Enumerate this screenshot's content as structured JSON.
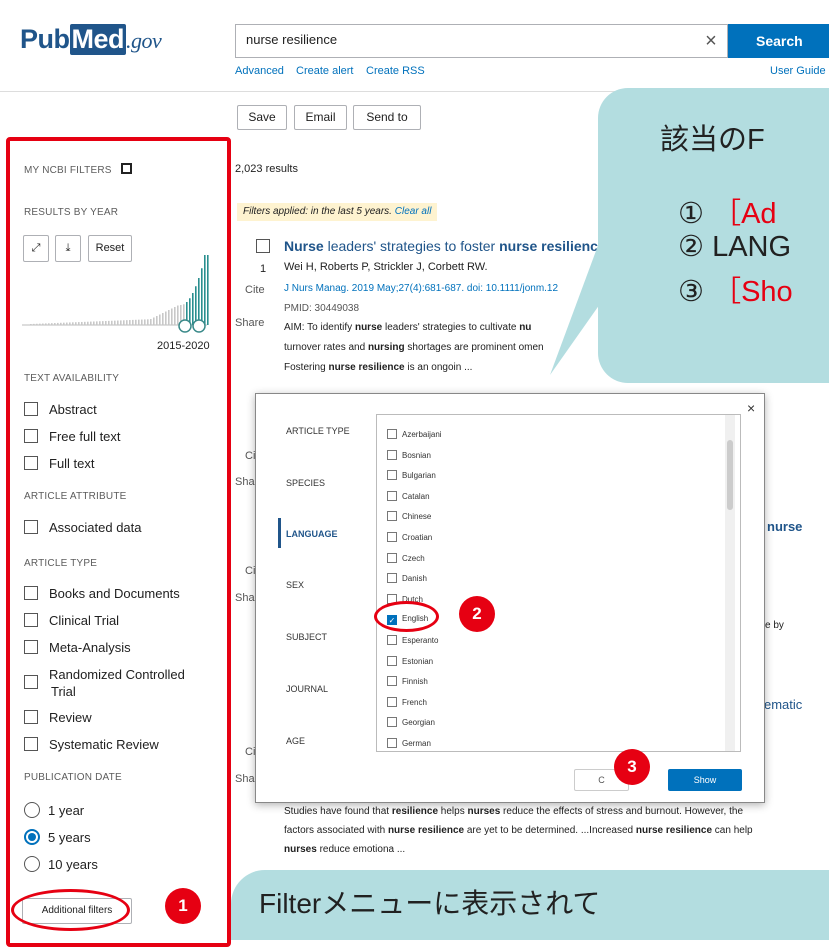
{
  "header": {
    "logo_pub": "Pub",
    "logo_med": "Med",
    "logo_gov": ".gov",
    "search_value": "nurse resilience",
    "clear_icon": "×",
    "search_label": "Search",
    "links": [
      "Advanced",
      "Create alert",
      "Create RSS"
    ],
    "user_guide": "User Guide"
  },
  "toolbar": {
    "save": "Save",
    "email": "Email",
    "send_to": "Send to",
    "s": "S"
  },
  "sidebar": {
    "my_ncbi": "MY NCBI FILTERS",
    "results_by_year": "RESULTS BY YEAR",
    "reset": "Reset",
    "year_range": "2015-2020",
    "text_availability": "TEXT AVAILABILITY",
    "text_items": [
      "Abstract",
      "Free full text",
      "Full text"
    ],
    "article_attribute": "ARTICLE ATTRIBUTE",
    "attribute_items": [
      "Associated data"
    ],
    "article_type": "ARTICLE TYPE",
    "type_items": [
      "Books and Documents",
      "Clinical Trial",
      "Meta-Analysis",
      "Randomized Controlled",
      "Trial",
      "Review",
      "Systematic Review"
    ],
    "publication_date": "PUBLICATION DATE",
    "date_items": [
      "1 year",
      "5 years",
      "10 years"
    ],
    "date_selected": 1,
    "additional_filters": "Additional filters"
  },
  "results": {
    "count": "2,023 results",
    "filters_applied": "Filters applied: in the last 5 years.",
    "clear_all": "Clear all",
    "item1": {
      "number": "1",
      "title_a": "Nurse",
      "title_b": " leaders' strategies to foster ",
      "title_c": "nurse resilienc",
      "authors": "Wei H, Roberts P, Strickler J, Corbett RW.",
      "cite": "Cite",
      "share": "Share",
      "journal": "J Nurs Manag. 2019 May;27(4):681-687. doi: 10.1111/jonm.12",
      "pmid": "PMID: 30449038",
      "abstract_a": "AIM: To identify ",
      "abstract_b": "nurse",
      "abstract_c": " leaders' strategies to cultivate ",
      "abstract_d": "nu",
      "abstract_line2_a": "turnover rates and ",
      "abstract_line2_b": "nursing",
      "abstract_line2_c": " shortages are prominent ",
      "abstract_line2_d": "omen",
      "abstract_line3_a": "Fostering ",
      "abstract_line3_b": "nurse resilience",
      "abstract_line3_c": " is an ongoin ..."
    },
    "partial_ci": "Ci",
    "partial_sha": "Sha",
    "nurse_frag": "nurse",
    "eby_frag": "e by",
    "ematic_frag": "ematic",
    "bottom_line1_a": "Studies have found that ",
    "bottom_line1_b": "resilience",
    "bottom_line1_c": " helps ",
    "bottom_line1_d": "nurses",
    "bottom_line1_e": " reduce the effects of stress and burnout. However, the",
    "bottom_line2_a": "factors associated with ",
    "bottom_line2_b": "nurse resilience",
    "bottom_line2_c": " are yet to be determined. ...Increased ",
    "bottom_line2_d": "nurse resilience",
    "bottom_line2_e": " can help",
    "bottom_line3_a": "nurses",
    "bottom_line3_b": " reduce emotiona ..."
  },
  "modal": {
    "close": "×",
    "categories": [
      "ARTICLE TYPE",
      "SPECIES",
      "LANGUAGE",
      "SEX",
      "SUBJECT",
      "JOURNAL",
      "AGE"
    ],
    "active_category": 2,
    "languages": [
      "Azerbaijani",
      "Bosnian",
      "Bulgarian",
      "Catalan",
      "Chinese",
      "Croatian",
      "Czech",
      "Danish",
      "Dutch",
      "English",
      "Esperanto",
      "Estonian",
      "Finnish",
      "French",
      "Georgian",
      "German"
    ],
    "checked_language": 9,
    "cancel": "C",
    "show": "Show"
  },
  "callouts": {
    "top_line1": "該当のF",
    "top_line2_num": "①",
    "top_line2_text": "［Ad",
    "top_line3_num": "②",
    "top_line3_text": "LANG",
    "top_line4_num": "③",
    "top_line4_text": "［Sho",
    "bottom": "Filterメニューに表示されて"
  },
  "badges": [
    "1",
    "2",
    "3"
  ],
  "colors": {
    "brand": "#20558a",
    "accent": "#0071bc",
    "annotation_red": "#e60012",
    "callout_bg": "#b3dde0"
  }
}
